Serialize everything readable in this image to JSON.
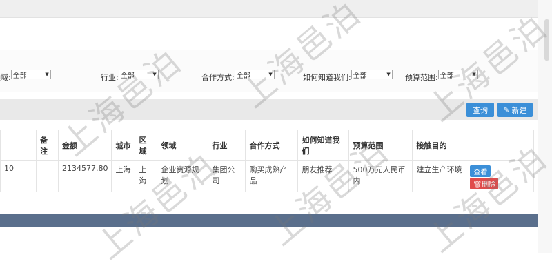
{
  "filters": [
    {
      "label": "领域:",
      "value": "全部"
    },
    {
      "label": "行业:",
      "value": "全部"
    },
    {
      "label": "合作方式:",
      "value": "全部"
    },
    {
      "label": "如何知道我们:",
      "value": "全部"
    },
    {
      "label": "预算范围:",
      "value": "全部"
    }
  ],
  "toolbar": {
    "query_label": "查询",
    "new_label": "新建"
  },
  "table": {
    "headers": [
      "",
      "备注",
      "金额",
      "城市",
      "区域",
      "领域",
      "行业",
      "合作方式",
      "如何知道我们",
      "预算范围",
      "接触目的",
      ""
    ],
    "rows": [
      {
        "cells": [
          "10",
          "",
          "2134577.80",
          "上海",
          "上海",
          "企业资源规划",
          "集团公司",
          "购买成熟产品",
          "朋友推荐",
          "500万元人民币内",
          "建立生产环境"
        ],
        "actions": {
          "view": "查看",
          "delete": "删除"
        }
      }
    ]
  },
  "watermark": "上海邑泊"
}
